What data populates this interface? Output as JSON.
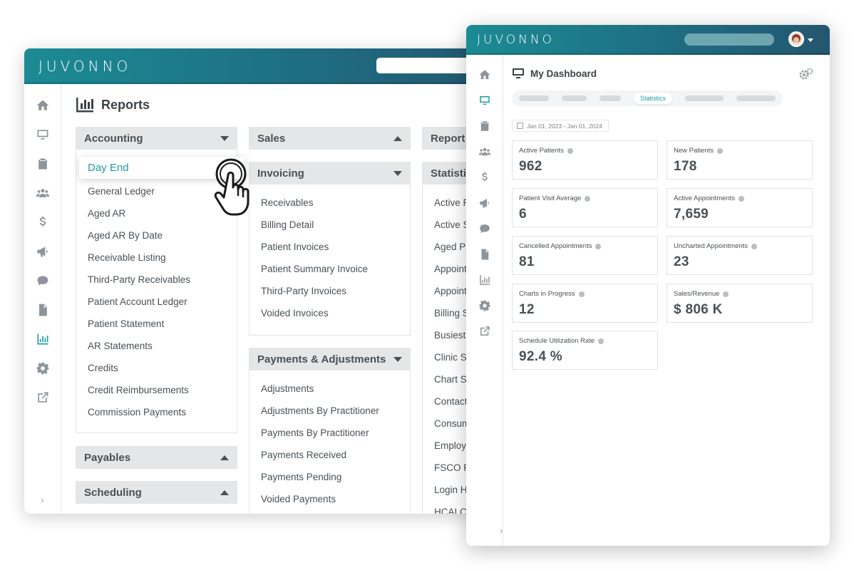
{
  "back_window": {
    "logo": "JUVONNO",
    "page_title": "Reports",
    "accounting": {
      "header": "Accounting",
      "items": [
        "Day End",
        "General Ledger",
        "Aged AR",
        "Aged AR By Date",
        "Receivable Listing",
        "Third-Party Receivables",
        "Patient Account Ledger",
        "Patient Statement",
        "AR Statements",
        "Credits",
        "Credit Reimbursements",
        "Commission Payments"
      ]
    },
    "payables": {
      "header": "Payables"
    },
    "scheduling": {
      "header": "Scheduling"
    },
    "sales": {
      "header": "Sales"
    },
    "invoicing": {
      "header": "Invoicing",
      "items": [
        "Receivables",
        "Billing Detail",
        "Patient Invoices",
        "Patient Summary Invoice",
        "Third-Party Invoices",
        "Voided Invoices"
      ]
    },
    "payments": {
      "header": "Payments & Adjustments",
      "items": [
        "Adjustments",
        "Adjustments By Practitioner",
        "Payments By Practitioner",
        "Payments Received",
        "Payments Pending",
        "Voided Payments"
      ]
    },
    "report_col": {
      "header": "Report"
    },
    "statistics": {
      "header": "Statisti",
      "items": [
        "Active P",
        "Active S",
        "Aged Pa",
        "Appoint",
        "Appoint",
        "Billing S",
        "Busiest T",
        "Clinic St",
        "Chart St",
        "Contacts",
        "Consum",
        "Employe",
        "FSCO Re",
        "Login Hi",
        "HCAI Co"
      ]
    }
  },
  "front_window": {
    "logo": "JUVONNO",
    "title": "My Dashboard",
    "active_tab": "Statistics",
    "date_range": "Jan 01, 2023 - Jan 01, 2024",
    "cards": [
      {
        "label": "Active Patients",
        "value": "962"
      },
      {
        "label": "New Patients",
        "value": "178"
      },
      {
        "label": "Patient Visit Average",
        "value": "6"
      },
      {
        "label": "Active Appointments",
        "value": "7,659"
      },
      {
        "label": "Cancelled Appointments",
        "value": "81"
      },
      {
        "label": "Uncharted Appointments",
        "value": "23"
      },
      {
        "label": "Charts in Progress",
        "value": "12"
      },
      {
        "label": "Sales/Revenue",
        "value": "$ 806 K"
      },
      {
        "label": "Schedule Utilization Rate",
        "value": "92.4 %"
      }
    ]
  },
  "colors": {
    "accent": "#1e9ba5",
    "header_start": "#1c8b94",
    "header_end": "#24566f"
  },
  "sidebar_icons": [
    "home-icon",
    "monitor-icon",
    "clipboard-icon",
    "users-icon",
    "dollar-icon",
    "megaphone-icon",
    "chat-icon",
    "document-icon",
    "chart-icon",
    "gear-icon",
    "external-link-icon"
  ]
}
